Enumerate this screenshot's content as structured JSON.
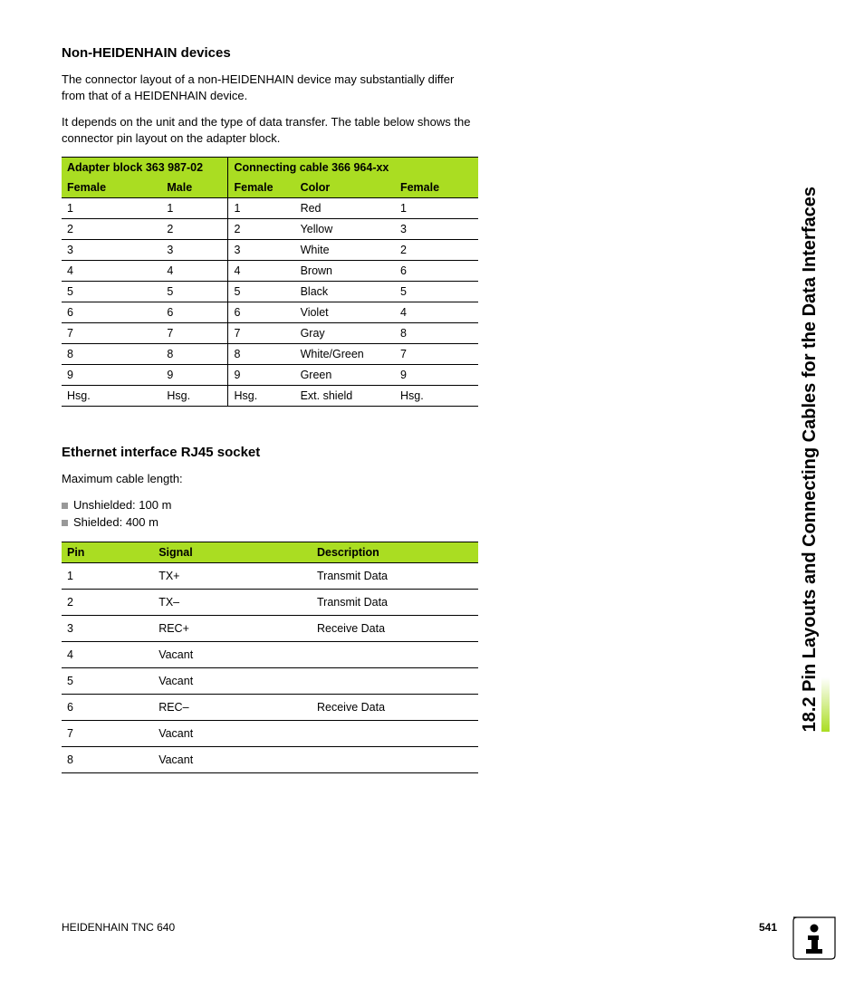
{
  "section1": {
    "heading": "Non-HEIDENHAIN devices",
    "para1": "The connector layout of a non-HEIDENHAIN device may substantially differ from that of a HEIDENHAIN device.",
    "para2": "It depends on the unit and the type of data transfer. The table below shows the connector pin layout on the adapter block."
  },
  "table1": {
    "group1": "Adapter block 363 987-02",
    "group2": "Connecting cable 366 964-xx",
    "headers": [
      "Female",
      "Male",
      "Female",
      "Color",
      "Female"
    ],
    "rows": [
      [
        "1",
        "1",
        "1",
        "Red",
        "1"
      ],
      [
        "2",
        "2",
        "2",
        "Yellow",
        "3"
      ],
      [
        "3",
        "3",
        "3",
        "White",
        "2"
      ],
      [
        "4",
        "4",
        "4",
        "Brown",
        "6"
      ],
      [
        "5",
        "5",
        "5",
        "Black",
        "5"
      ],
      [
        "6",
        "6",
        "6",
        "Violet",
        "4"
      ],
      [
        "7",
        "7",
        "7",
        "Gray",
        "8"
      ],
      [
        "8",
        "8",
        "8",
        "White/Green",
        "7"
      ],
      [
        "9",
        "9",
        "9",
        "Green",
        "9"
      ],
      [
        "Hsg.",
        "Hsg.",
        "Hsg.",
        "Ext. shield",
        "Hsg."
      ]
    ]
  },
  "section2": {
    "heading": "Ethernet interface RJ45 socket",
    "para1": "Maximum cable length:",
    "bullets": [
      "Unshielded: 100 m",
      "Shielded: 400 m"
    ]
  },
  "table2": {
    "headers": [
      "Pin",
      "Signal",
      "Description"
    ],
    "rows": [
      [
        "1",
        "TX+",
        "Transmit Data"
      ],
      [
        "2",
        "TX–",
        "Transmit Data"
      ],
      [
        "3",
        "REC+",
        "Receive Data"
      ],
      [
        "4",
        "Vacant",
        ""
      ],
      [
        "5",
        "Vacant",
        ""
      ],
      [
        "6",
        "REC–",
        "Receive Data"
      ],
      [
        "7",
        "Vacant",
        ""
      ],
      [
        "8",
        "Vacant",
        ""
      ]
    ]
  },
  "sidebar": "18.2 Pin Layouts and Connecting Cables for the Data Interfaces",
  "footer": {
    "left": "HEIDENHAIN TNC 640",
    "page": "541"
  }
}
